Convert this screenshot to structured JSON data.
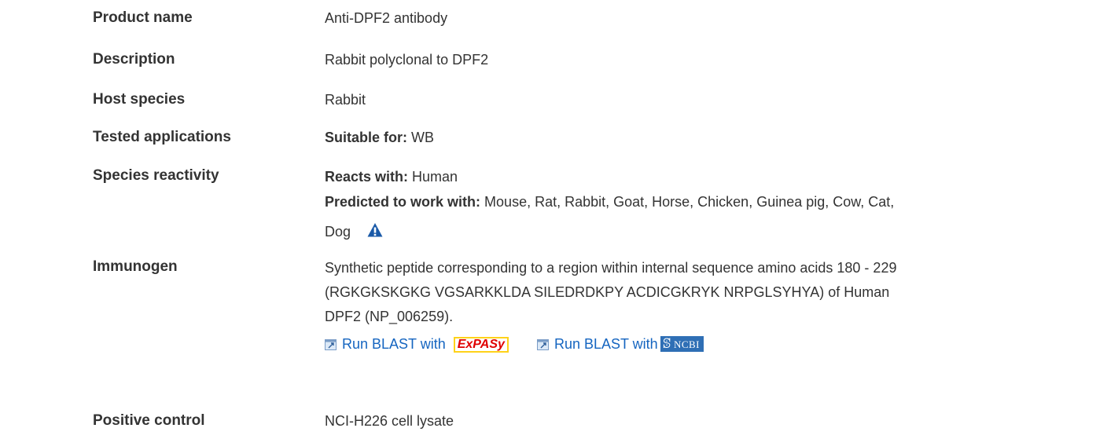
{
  "rows": [
    {
      "label": "Product name",
      "value": "Anti-DPF2 antibody"
    },
    {
      "label": "Description",
      "value": "Rabbit polyclonal to DPF2"
    },
    {
      "label": "Host species",
      "value": "Rabbit"
    },
    {
      "label": "Tested applications",
      "prefix": "Suitable for:",
      "value": "WB"
    },
    {
      "label": "Species reactivity",
      "reacts_prefix": "Reacts with:",
      "reacts_value": "Human",
      "predicted_prefix": "Predicted to work with:",
      "predicted_value_line1": "Mouse, Rat, Rabbit, Goat, Horse, Chicken, Guinea pig, Cow, Cat,",
      "predicted_value_line2": "Dog",
      "warning_icon": "warning-triangle-icon"
    },
    {
      "label": "Immunogen",
      "line1": "Synthetic peptide corresponding to a region within internal sequence amino acids 180 - 229",
      "line2": "(RGKGKSKGKG VGSARKKLDA SILEDRDKPY ACDICGKRYK NRPGLSYHYA) of Human",
      "line3": "DPF2 (NP_006259).",
      "blast1_text": "Run BLAST with",
      "blast1_logo": "ExPASy",
      "blast2_text": "Run BLAST with",
      "blast2_logo": "NCBI",
      "ext_icon": "external-window-icon"
    },
    {
      "label": "Positive control",
      "value": "NCI-H226 cell lysate"
    }
  ],
  "colors": {
    "text": "#333333",
    "link": "#1565c0",
    "warning": "#1a5aa8",
    "ncbi_bg": "#2f6fb5",
    "expasy_red": "#e00000",
    "expasy_border": "#ffd21a"
  }
}
